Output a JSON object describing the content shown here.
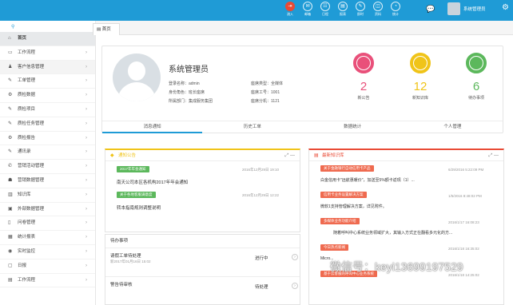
{
  "topbar": {
    "icons": [
      {
        "label": "流入",
        "glyph": "⇥",
        "name": "inflow-icon"
      },
      {
        "label": "邮箱",
        "glyph": "✉",
        "name": "mail-icon"
      },
      {
        "label": "日程",
        "glyph": "☷",
        "name": "calendar-icon"
      },
      {
        "label": "报表",
        "glyph": "▤",
        "name": "report-icon"
      },
      {
        "label": "即时",
        "glyph": "✎",
        "name": "instant-icon"
      },
      {
        "label": "资料",
        "glyph": "◫",
        "name": "data-icon"
      },
      {
        "label": "统计",
        "glyph": "◔",
        "name": "stats-icon"
      }
    ],
    "user_name": "系统管理员",
    "active_color": "#e94a35",
    "bar_color": "#1f9bd6"
  },
  "sidebar": {
    "search_glyph": "🔍",
    "items": [
      {
        "label": "首页",
        "icon": "home-icon",
        "glyph": "⌂"
      },
      {
        "label": "工作流程",
        "icon": "monitor-icon",
        "glyph": "▭"
      },
      {
        "label": "客户信息管理",
        "icon": "user-icon",
        "glyph": "♟"
      },
      {
        "label": "工单管理",
        "icon": "edit-icon",
        "glyph": "✎"
      },
      {
        "label": "质检数据",
        "icon": "cogs-icon",
        "glyph": "⚙"
      },
      {
        "label": "质检项目",
        "icon": "edit-icon",
        "glyph": "✎"
      },
      {
        "label": "质检任务管理",
        "icon": "edit-icon",
        "glyph": "✎"
      },
      {
        "label": "质检报告",
        "icon": "cogs-icon",
        "glyph": "⚙"
      },
      {
        "label": "通讯录",
        "icon": "edit-icon",
        "glyph": "✎"
      },
      {
        "label": "营销活动管理",
        "icon": "phone-icon",
        "glyph": "✆"
      },
      {
        "label": "营销数据管理",
        "icon": "group-icon",
        "glyph": "☗"
      },
      {
        "label": "知识库",
        "icon": "book-icon",
        "glyph": "▥"
      },
      {
        "label": "外部数据管理",
        "icon": "lock-icon",
        "glyph": "▣"
      },
      {
        "label": "问卷管理",
        "icon": "doc-icon",
        "glyph": "▯"
      },
      {
        "label": "统计报表",
        "icon": "grid-icon",
        "glyph": "▦"
      },
      {
        "label": "实时监控",
        "icon": "eye-icon",
        "glyph": "◉"
      },
      {
        "label": "日报",
        "icon": "cabinet-icon",
        "glyph": "▢"
      },
      {
        "label": "工作流程",
        "icon": "flow-icon",
        "glyph": "▤"
      }
    ]
  },
  "tabs": {
    "home": "首页"
  },
  "profile": {
    "name": "系统管理员",
    "login_label": "登录名称：admin",
    "role_label": "身份角色：班长座席",
    "dept_label": "所属部门：集成服务集团",
    "type_label": "座席类型：全媒体",
    "agent_no": "座席工号：1001",
    "ext": "座席分机：1121",
    "stats": [
      {
        "value": "2",
        "label": "新公告",
        "color": "#e9507a"
      },
      {
        "value": "12",
        "label": "新知识库",
        "color": "#f0c419"
      },
      {
        "value": "6",
        "label": "待办事项",
        "color": "#5cb85c"
      }
    ],
    "tabs": [
      "消息通知",
      "历史工单",
      "数据统计",
      "个人管理"
    ]
  },
  "notice": {
    "title": "通知公告",
    "items": [
      {
        "tag": "2017年年会通知",
        "date": "2016年12月29日 19:10",
        "text": "南天公司本区各机构2017年年会通知"
      },
      {
        "tag": "关于各地客服满意度",
        "date": "2016年12月29日 12:22",
        "text": "转本指南规则调整说明"
      }
    ]
  },
  "todo": {
    "title": "待办事项",
    "items": [
      {
        "name": "请假工单待处理",
        "date": "新2017年01月16日 15:02",
        "status": "进行中"
      },
      {
        "name": "警告待审核",
        "date": "",
        "status": "待处理"
      }
    ]
  },
  "knowledge": {
    "title": "最新知识库",
    "items": [
      {
        "tag": "关于金融银行自动信用卡产品",
        "date": "6/29/2016 5:22:09 PM",
        "text": "白金信用卡\"远航惠暖价\"，加送至5%额卡返现（1）..."
      },
      {
        "tag": "信用卡业务设置解决方案",
        "date": "1/5/2016 8:48:02 PM",
        "text": "微软1支持管理解决方案，详见附件。"
      },
      {
        "tag": "多媒体业务功能介绍",
        "date": "2016/1/17 16:08:23",
        "text": "随着呼叫中心系统业务领域扩大，其输入方式正在翻看多元化的方..."
      },
      {
        "tag": "今日热点新闻",
        "date": "2016/1/18 16:35:02",
        "text": "Micro..."
      },
      {
        "tag": "基于云客服的呼叫中心业务系统",
        "date": "2016/1/18 14:25:02",
        "text": ""
      }
    ]
  },
  "watermark": "微信号：keyi13699197529"
}
